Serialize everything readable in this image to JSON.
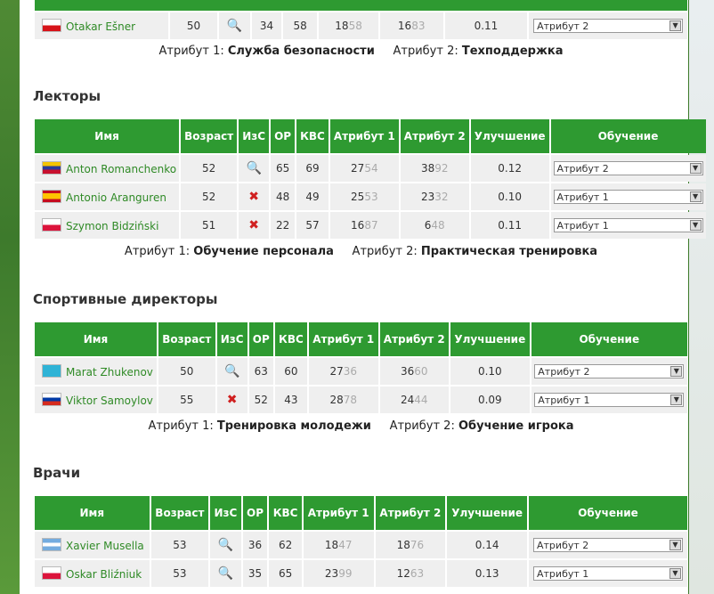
{
  "top_row": {
    "flag": "cz",
    "name": "Otakar Ešner",
    "age": "50",
    "ic": "mag",
    "op": "34",
    "kvs": "58",
    "a1": [
      "18",
      "58"
    ],
    "a2": [
      "16",
      "83"
    ],
    "imp": "0.11",
    "train": "Атрибут 2",
    "attr1_label": "Атрибут 1:",
    "attr1_value": "Служба безопасности",
    "attr2_label": "Атрибут 2:",
    "attr2_value": "Техподдержка"
  },
  "headers": [
    "Имя",
    "Возраст",
    "ИзС",
    "ОР",
    "КВС",
    "Атрибут 1",
    "Атрибут 2",
    "Улучшение",
    "Обучение"
  ],
  "sections": [
    {
      "title": "Лекторы",
      "rows": [
        {
          "flag": "ve",
          "name": "Anton Romanchenko",
          "age": "52",
          "ic": "mag",
          "op": "65",
          "kvs": "69",
          "a1": [
            "27",
            "54"
          ],
          "a2": [
            "38",
            "92"
          ],
          "imp": "0.12",
          "train": "Атрибут 2"
        },
        {
          "flag": "es",
          "name": "Antonio Aranguren",
          "age": "52",
          "ic": "x",
          "op": "48",
          "kvs": "49",
          "a1": [
            "25",
            "53"
          ],
          "a2": [
            "23",
            "32"
          ],
          "imp": "0.10",
          "train": "Атрибут 1"
        },
        {
          "flag": "pl",
          "name": "Szymon Bidziński",
          "age": "51",
          "ic": "x",
          "op": "22",
          "kvs": "57",
          "a1": [
            "16",
            "87"
          ],
          "a2": [
            "6",
            "48"
          ],
          "imp": "0.11",
          "train": "Атрибут 1"
        }
      ],
      "attr1_label": "Атрибут 1:",
      "attr1_value": "Обучение персонала",
      "attr2_label": "Атрибут 2:",
      "attr2_value": "Практическая тренировка"
    },
    {
      "title": "Спортивные директоры",
      "rows": [
        {
          "flag": "kz",
          "name": "Marat Zhukenov",
          "age": "50",
          "ic": "mag",
          "op": "63",
          "kvs": "60",
          "a1": [
            "27",
            "36"
          ],
          "a2": [
            "36",
            "60"
          ],
          "imp": "0.10",
          "train": "Атрибут 2"
        },
        {
          "flag": "ru",
          "name": "Viktor Samoylov",
          "age": "55",
          "ic": "x",
          "op": "52",
          "kvs": "43",
          "a1": [
            "28",
            "78"
          ],
          "a2": [
            "24",
            "44"
          ],
          "imp": "0.09",
          "train": "Атрибут 1"
        }
      ],
      "attr1_label": "Атрибут 1:",
      "attr1_value": "Тренировка молодежи",
      "attr2_label": "Атрибут 2:",
      "attr2_value": "Обучение игрока"
    },
    {
      "title": "Врачи",
      "rows": [
        {
          "flag": "ar",
          "name": "Xavier Musella",
          "age": "53",
          "ic": "mag",
          "op": "36",
          "kvs": "62",
          "a1": [
            "18",
            "47"
          ],
          "a2": [
            "18",
            "76"
          ],
          "imp": "0.14",
          "train": "Атрибут 2"
        },
        {
          "flag": "pl",
          "name": "Oskar Bliźniuk",
          "age": "53",
          "ic": "mag",
          "op": "35",
          "kvs": "65",
          "a1": [
            "23",
            "99"
          ],
          "a2": [
            "12",
            "63"
          ],
          "imp": "0.13",
          "train": "Атрибут 1"
        }
      ]
    }
  ],
  "colors": {
    "header_green": "#2e9a31",
    "name_green": "#2f8a26"
  }
}
